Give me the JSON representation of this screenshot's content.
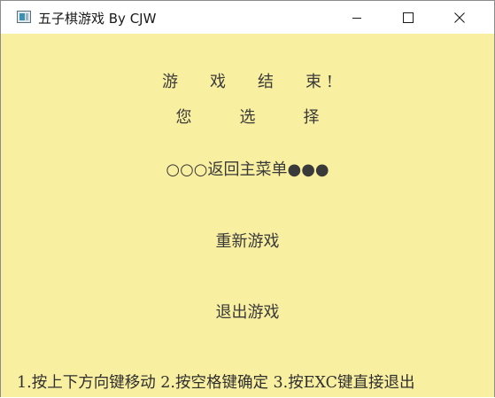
{
  "window": {
    "title": "五子棋游戏 By CJW"
  },
  "screen": {
    "heading": "游　　戏　　结　　束 !",
    "subheading": "您　　　选　　　择",
    "selected_option": "○○○返回主菜单●●●",
    "option_restart": "重新游戏",
    "option_quit": "退出游戏",
    "instructions": "1.按上下方向键移动 2.按空格键确定 3.按EXC键直接退出"
  },
  "colors": {
    "background": "#f9efa0",
    "text": "#3a3a3a"
  },
  "icons": {
    "app": "app-icon",
    "minimize": "minimize-icon",
    "maximize": "maximize-icon",
    "close": "close-icon"
  }
}
